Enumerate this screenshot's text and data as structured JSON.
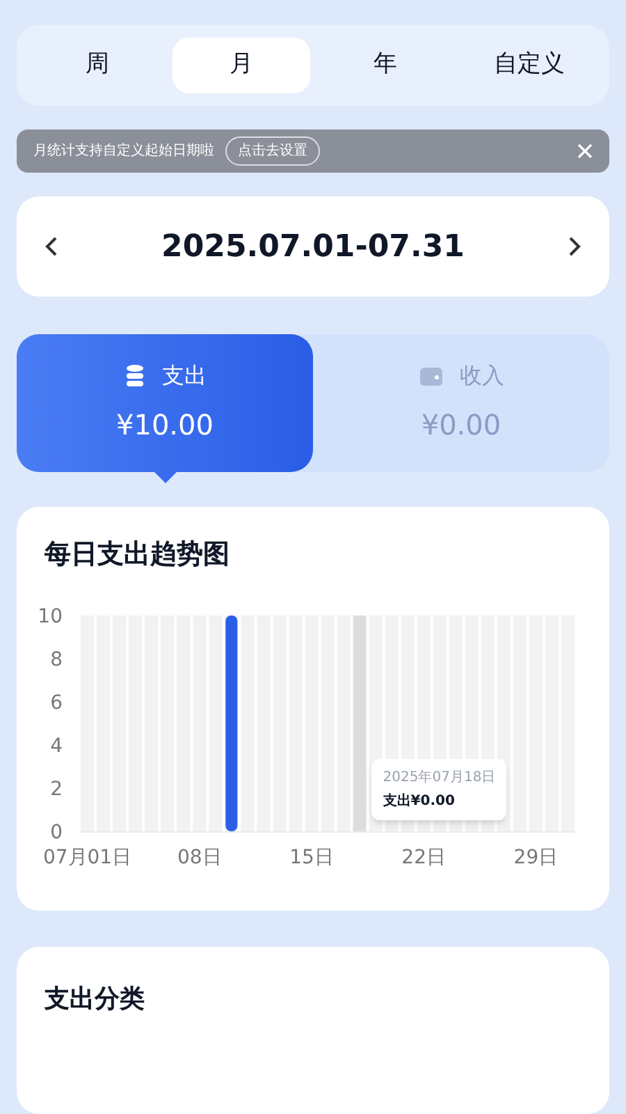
{
  "period_tabs": [
    {
      "label": "周",
      "selected": false
    },
    {
      "label": "月",
      "selected": true
    },
    {
      "label": "年",
      "selected": false
    },
    {
      "label": "自定义",
      "selected": false
    }
  ],
  "notice": {
    "text": "月统计支持自定义起始日期啦",
    "action": "点击去设置"
  },
  "date_range": "2025.07.01-07.31",
  "summary": [
    {
      "kind": "expense",
      "label": "支出",
      "amount": "¥10.00",
      "selected": true
    },
    {
      "kind": "income",
      "label": "收入",
      "amount": "¥0.00",
      "selected": false
    }
  ],
  "trend": {
    "title": "每日支出趋势图",
    "chart_data": {
      "type": "bar",
      "x": [
        1,
        2,
        3,
        4,
        5,
        6,
        7,
        8,
        9,
        10,
        11,
        12,
        13,
        14,
        15,
        16,
        17,
        18,
        19,
        20,
        21,
        22,
        23,
        24,
        25,
        26,
        27,
        28,
        29,
        30,
        31
      ],
      "series": [
        {
          "color": "#2b5ee8",
          "values": [
            0,
            0,
            0,
            0,
            0,
            0,
            0,
            0,
            0,
            10,
            0,
            0,
            0,
            0,
            0,
            0,
            0,
            0,
            0,
            0,
            0,
            0,
            0,
            0,
            0,
            0,
            0,
            0,
            0,
            0,
            0
          ]
        }
      ],
      "ylim": [
        0,
        10
      ],
      "yticks": [
        0,
        2,
        4,
        6,
        8,
        10
      ],
      "xticks": [
        {
          "value": 1,
          "label": "07月01日"
        },
        {
          "value": 8,
          "label": "08日"
        },
        {
          "value": 15,
          "label": "15日"
        },
        {
          "value": 22,
          "label": "22日"
        },
        {
          "value": 29,
          "label": "29日"
        }
      ],
      "xlim": [
        0.5,
        31.5
      ],
      "annotations": [
        {
          "x": 18,
          "y": 0,
          "text": "支出¥0.00"
        }
      ]
    },
    "tooltip_date": "2025年07月18日"
  },
  "category": {
    "title": "支出分类"
  }
}
